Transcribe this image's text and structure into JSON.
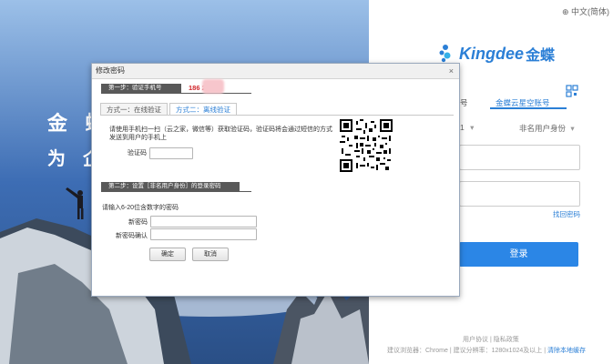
{
  "background": {
    "slogan_line1": "金 蝶",
    "slogan_line2": "为 企"
  },
  "login": {
    "language": "中文(简体)",
    "logo_text": "Kingdee",
    "logo_cn": "金蝶",
    "tab_left": "号",
    "tab_active": "金蝶云星空账号",
    "select_left": "1",
    "select_right": "非名用户身份",
    "forgot": "找回密码",
    "login_button": "登录",
    "footer_links": "用户协议 | 隐私政策",
    "footer_info": "建议浏览器：Chrome | 建议分辨率：1280x1024及以上 | ",
    "footer_clear": "清除本地缓存"
  },
  "dialog": {
    "title": "修改密码",
    "close": "×",
    "step1": "第一步：验证手机号",
    "phone": "186        216",
    "tab1": "方式一：在线验证",
    "tab2": "方式二：离线验证",
    "instruction_line1": "请使用手机扫一扫（云之家，微信等）获取验证码，验证码将会通过短信的方式",
    "instruction_line2": "发送到用户的手机上",
    "code_label": "验证码",
    "step2": "第二步：设置［非名用户身份］的登录密码",
    "hint": "请输入6-20位含数字的密码",
    "new_pwd_label": "新密码",
    "confirm_pwd_label": "新密码确认",
    "confirm_btn": "确定",
    "cancel_btn": "取消"
  },
  "colors": {
    "accent": "#2b7fd6",
    "phone_red": "#d1262b",
    "step_bar": "#595959"
  }
}
